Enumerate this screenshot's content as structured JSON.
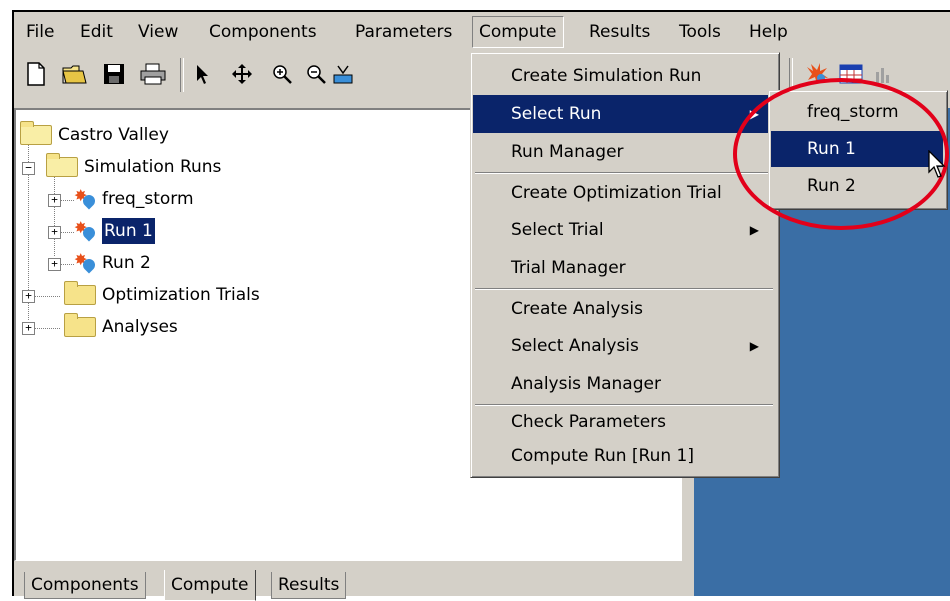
{
  "menubar": {
    "items": [
      "File",
      "Edit",
      "View",
      "Components",
      "Parameters",
      "Compute",
      "Results",
      "Tools",
      "Help"
    ],
    "active": "Compute"
  },
  "toolbar": {
    "icons": [
      "new-file-icon",
      "open-folder-icon",
      "save-icon",
      "print-icon",
      "pointer-arrow-icon",
      "pan-move-icon",
      "zoom-in-icon",
      "zoom-out-icon",
      "compute-icon"
    ]
  },
  "toolbar_right": {
    "icons": [
      "run-compute-icon",
      "results-table-icon",
      "graph-icon"
    ]
  },
  "tree": {
    "root": "Castro Valley",
    "simulation_runs": "Simulation Runs",
    "runs": [
      "freq_storm",
      "Run 1",
      "Run 2"
    ],
    "selected_run": "Run 1",
    "optimization_trials": "Optimization Trials",
    "analyses": "Analyses"
  },
  "tabs": [
    "Components",
    "Compute",
    "Results"
  ],
  "active_tab": "Compute",
  "compute_menu": {
    "items": [
      {
        "label": "Create Simulation Run",
        "submenu": false
      },
      {
        "label": "Select Run",
        "submenu": true,
        "highlighted": true
      },
      {
        "label": "Run Manager",
        "submenu": false
      },
      {
        "label": "Create Optimization Trial",
        "submenu": false
      },
      {
        "label": "Select Trial",
        "submenu": true
      },
      {
        "label": "Trial Manager",
        "submenu": false
      },
      {
        "label": "Create Analysis",
        "submenu": false
      },
      {
        "label": "Select Analysis",
        "submenu": true
      },
      {
        "label": "Analysis Manager",
        "submenu": false
      },
      {
        "label": "Check Parameters",
        "submenu": false
      },
      {
        "label": "Compute Run [Run 1]",
        "submenu": false
      }
    ]
  },
  "select_run_submenu": {
    "items": [
      "freq_storm",
      "Run 1",
      "Run 2"
    ],
    "highlighted": "Run 1"
  },
  "colors": {
    "window_bg": "#d4d0c8",
    "selection": "#0a246a",
    "pane_blue": "#3a6ea5",
    "annotation_red": "#e2001a"
  }
}
